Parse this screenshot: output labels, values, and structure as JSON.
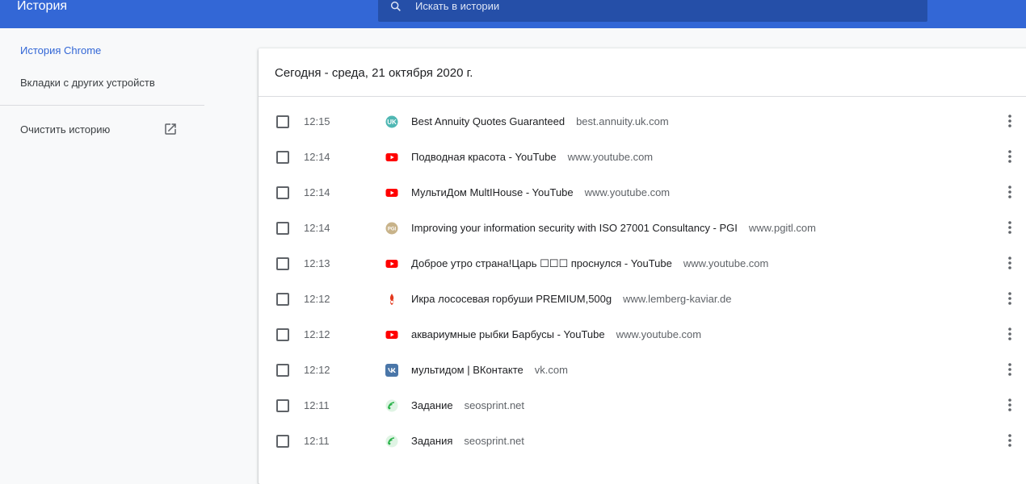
{
  "toolbar": {
    "title": "История",
    "search_placeholder": "Искать в истории"
  },
  "sidebar": {
    "items": [
      {
        "label": "История Chrome",
        "active": true
      },
      {
        "label": "Вкладки с других устройств",
        "active": false
      }
    ],
    "clear_label": "Очистить историю"
  },
  "main": {
    "date_header": "Сегодня - среда, 21 октября 2020 г.",
    "entries": [
      {
        "time": "12:15",
        "title": "Best Annuity Quotes Guaranteed",
        "domain": "best.annuity.uk.com",
        "icon": "uk-icon"
      },
      {
        "time": "12:14",
        "title": "Подводная красота - YouTube",
        "domain": "www.youtube.com",
        "icon": "youtube-icon"
      },
      {
        "time": "12:14",
        "title": "МультиДом MultIHouse - YouTube",
        "domain": "www.youtube.com",
        "icon": "youtube-icon"
      },
      {
        "time": "12:14",
        "title": "Improving your information security with ISO 27001 Consultancy - PGI",
        "domain": "www.pgitl.com",
        "icon": "pgi-icon"
      },
      {
        "time": "12:13",
        "title": "Доброе утро страна!Царь ☐☐☐ проснулся - YouTube",
        "domain": "www.youtube.com",
        "icon": "youtube-icon"
      },
      {
        "time": "12:12",
        "title": "Икра лососевая горбуши PREMIUM,500g",
        "domain": "www.lemberg-kaviar.de",
        "icon": "lemberg-icon"
      },
      {
        "time": "12:12",
        "title": "аквариумные рыбки Барбусы - YouTube",
        "domain": "www.youtube.com",
        "icon": "youtube-icon"
      },
      {
        "time": "12:12",
        "title": "мультидом | ВКонтакте",
        "domain": "vk.com",
        "icon": "vk-icon"
      },
      {
        "time": "12:11",
        "title": "Задание",
        "domain": "seosprint.net",
        "icon": "seosprint-icon"
      },
      {
        "time": "12:11",
        "title": "Задания",
        "domain": "seosprint.net",
        "icon": "seosprint-icon"
      }
    ]
  },
  "colors": {
    "toolbar": "#3367d6",
    "search": "#254fa8",
    "accent": "#3367d6",
    "youtube": "#ff0000",
    "vk": "#4a76a8",
    "seosprint": "#2bb34b"
  }
}
